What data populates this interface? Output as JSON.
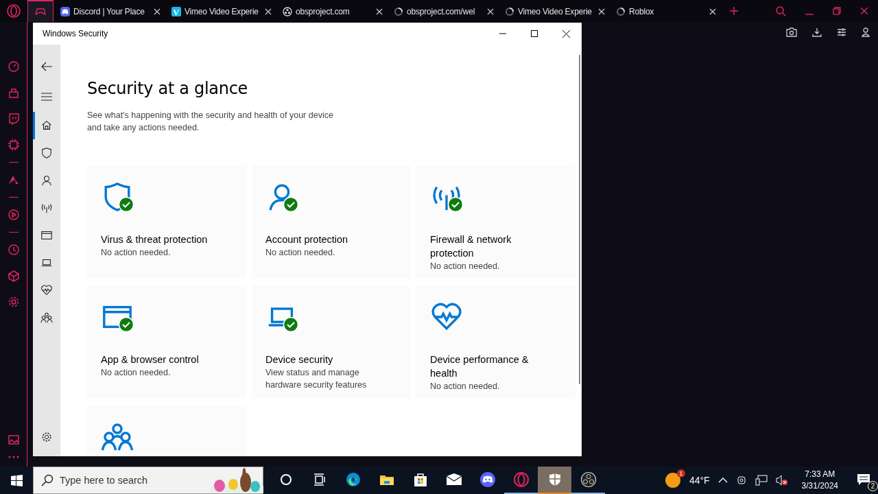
{
  "browser": {
    "tabs": [
      {
        "kind": "gx",
        "selected": true
      },
      {
        "kind": "discord",
        "label": "Discord | Your Place",
        "selected": false
      },
      {
        "kind": "vimeo",
        "label": "Vimeo Video Experie",
        "selected": false
      },
      {
        "kind": "obs",
        "label": "obsproject.com",
        "selected": false
      },
      {
        "kind": "loading",
        "label": "obsproject.com/wel",
        "selected": false
      },
      {
        "kind": "loading",
        "label": "Vimeo Video Experie",
        "selected": false
      },
      {
        "kind": "loading",
        "label": "Roblox",
        "selected": false
      }
    ]
  },
  "window": {
    "title": "Windows Security",
    "nav": [
      {
        "kind": "home",
        "selected": true
      },
      {
        "kind": "shield",
        "selected": false
      },
      {
        "kind": "person",
        "selected": false
      },
      {
        "kind": "antenna",
        "selected": false
      },
      {
        "kind": "browser",
        "selected": false
      },
      {
        "kind": "laptop",
        "selected": false
      },
      {
        "kind": "heart",
        "selected": false
      },
      {
        "kind": "family",
        "selected": false
      }
    ],
    "heading": "Security at a glance",
    "description": "See what's happening with the security and health of your device and take any actions needed.",
    "cards": [
      {
        "kind": "shield",
        "title": "Virus & threat protection",
        "status": "No action needed.",
        "ok": true
      },
      {
        "kind": "person",
        "title": "Account protection",
        "status": "No action needed.",
        "ok": true
      },
      {
        "kind": "antenna",
        "title": "Firewall & network protection",
        "status": "No action needed.",
        "ok": true
      },
      {
        "kind": "browser",
        "title": "App & browser control",
        "status": "No action needed.",
        "ok": true
      },
      {
        "kind": "laptop",
        "title": "Device security",
        "status": "View status and manage hardware security features",
        "ok": true
      },
      {
        "kind": "heart",
        "title": "Device performance & health",
        "status": "No action needed.",
        "ok": false
      },
      {
        "kind": "family",
        "ok": false
      }
    ]
  },
  "taskbar": {
    "search": {
      "placeholder": "Type here to search"
    },
    "apps": [
      {
        "kind": "cortana",
        "running": false,
        "active": false
      },
      {
        "kind": "taskview",
        "running": false,
        "active": false
      },
      {
        "kind": "edge",
        "running": false,
        "active": false
      },
      {
        "kind": "explorer",
        "running": false,
        "active": false
      },
      {
        "kind": "store",
        "running": false,
        "active": false
      },
      {
        "kind": "mail",
        "running": false,
        "active": false
      },
      {
        "kind": "discord",
        "running": false,
        "active": false
      },
      {
        "kind": "opera",
        "running": true,
        "active": false
      },
      {
        "kind": "security",
        "running": true,
        "active": true
      },
      {
        "kind": "obs",
        "running": true,
        "active": false
      }
    ],
    "weather": {
      "temperature": "44°F",
      "badge": "1"
    },
    "time": "7:33 AM",
    "date": "3/31/2024",
    "notifications": "2"
  }
}
